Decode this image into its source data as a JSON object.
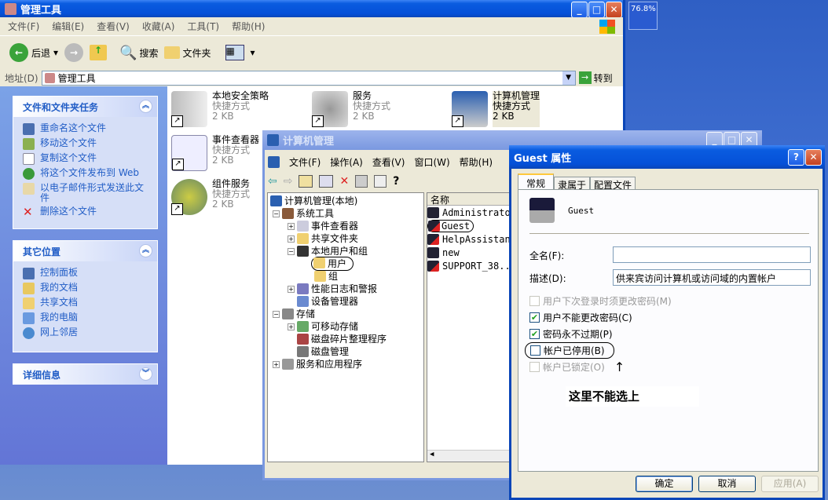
{
  "zoom_badge": "76.8%",
  "explorer": {
    "title": "管理工具",
    "menu": [
      "文件(F)",
      "编辑(E)",
      "查看(V)",
      "收藏(A)",
      "工具(T)",
      "帮助(H)"
    ],
    "toolbar": {
      "back": "后退",
      "search": "搜索",
      "folders": "文件夹"
    },
    "address_label": "地址(D)",
    "address_value": "管理工具",
    "go": "转到",
    "tasks": {
      "title": "文件和文件夹任务",
      "items": [
        "重命名这个文件",
        "移动这个文件",
        "复制这个文件",
        "将这个文件发布到 Web",
        "以电子邮件形式发送此文件",
        "删除这个文件"
      ]
    },
    "places": {
      "title": "其它位置",
      "items": [
        "控制面板",
        "我的文档",
        "共享文档",
        "我的电脑",
        "网上邻居"
      ]
    },
    "details": {
      "title": "详细信息"
    },
    "files": [
      {
        "name": "本地安全策略",
        "type": "快捷方式",
        "size": "2 KB"
      },
      {
        "name": "服务",
        "type": "快捷方式",
        "size": "2 KB"
      },
      {
        "name": "计算机管理",
        "type": "快捷方式",
        "size": "2 KB"
      },
      {
        "name": "事件查看器",
        "type": "快捷方式",
        "size": "2 KB"
      },
      {
        "name": "组件服务",
        "type": "快捷方式",
        "size": "2 KB"
      }
    ]
  },
  "mmc": {
    "title": "计算机管理",
    "menu": [
      "文件(F)",
      "操作(A)",
      "查看(V)",
      "窗口(W)",
      "帮助(H)"
    ],
    "tree": [
      "计算机管理(本地)",
      "系统工具",
      "事件查看器",
      "共享文件夹",
      "本地用户和组",
      "用户",
      "组",
      "性能日志和警报",
      "设备管理器",
      "存储",
      "可移动存储",
      "磁盘碎片整理程序",
      "磁盘管理",
      "服务和应用程序"
    ],
    "list_header": "名称",
    "users": [
      "Administrator",
      "Guest",
      "HelpAssistant",
      "new",
      "SUPPORT_38..."
    ]
  },
  "dialog": {
    "title": "Guest 属性",
    "tabs": [
      "常规",
      "隶属于",
      "配置文件"
    ],
    "username": "Guest",
    "fullname_label": "全名(F):",
    "fullname_value": "",
    "desc_label": "描述(D):",
    "desc_value": "供来宾访问计算机或访问域的内置帐户",
    "checks": [
      {
        "label": "用户下次登录时须更改密码(M)",
        "checked": false,
        "disabled": true
      },
      {
        "label": "用户不能更改密码(C)",
        "checked": true,
        "disabled": false
      },
      {
        "label": "密码永不过期(P)",
        "checked": true,
        "disabled": false
      },
      {
        "label": "帐户已停用(B)",
        "checked": false,
        "disabled": false
      },
      {
        "label": "帐户已锁定(O)",
        "checked": false,
        "disabled": true
      }
    ],
    "annotation": "这里不能选上",
    "ok": "确定",
    "cancel": "取消",
    "apply": "应用(A)"
  }
}
